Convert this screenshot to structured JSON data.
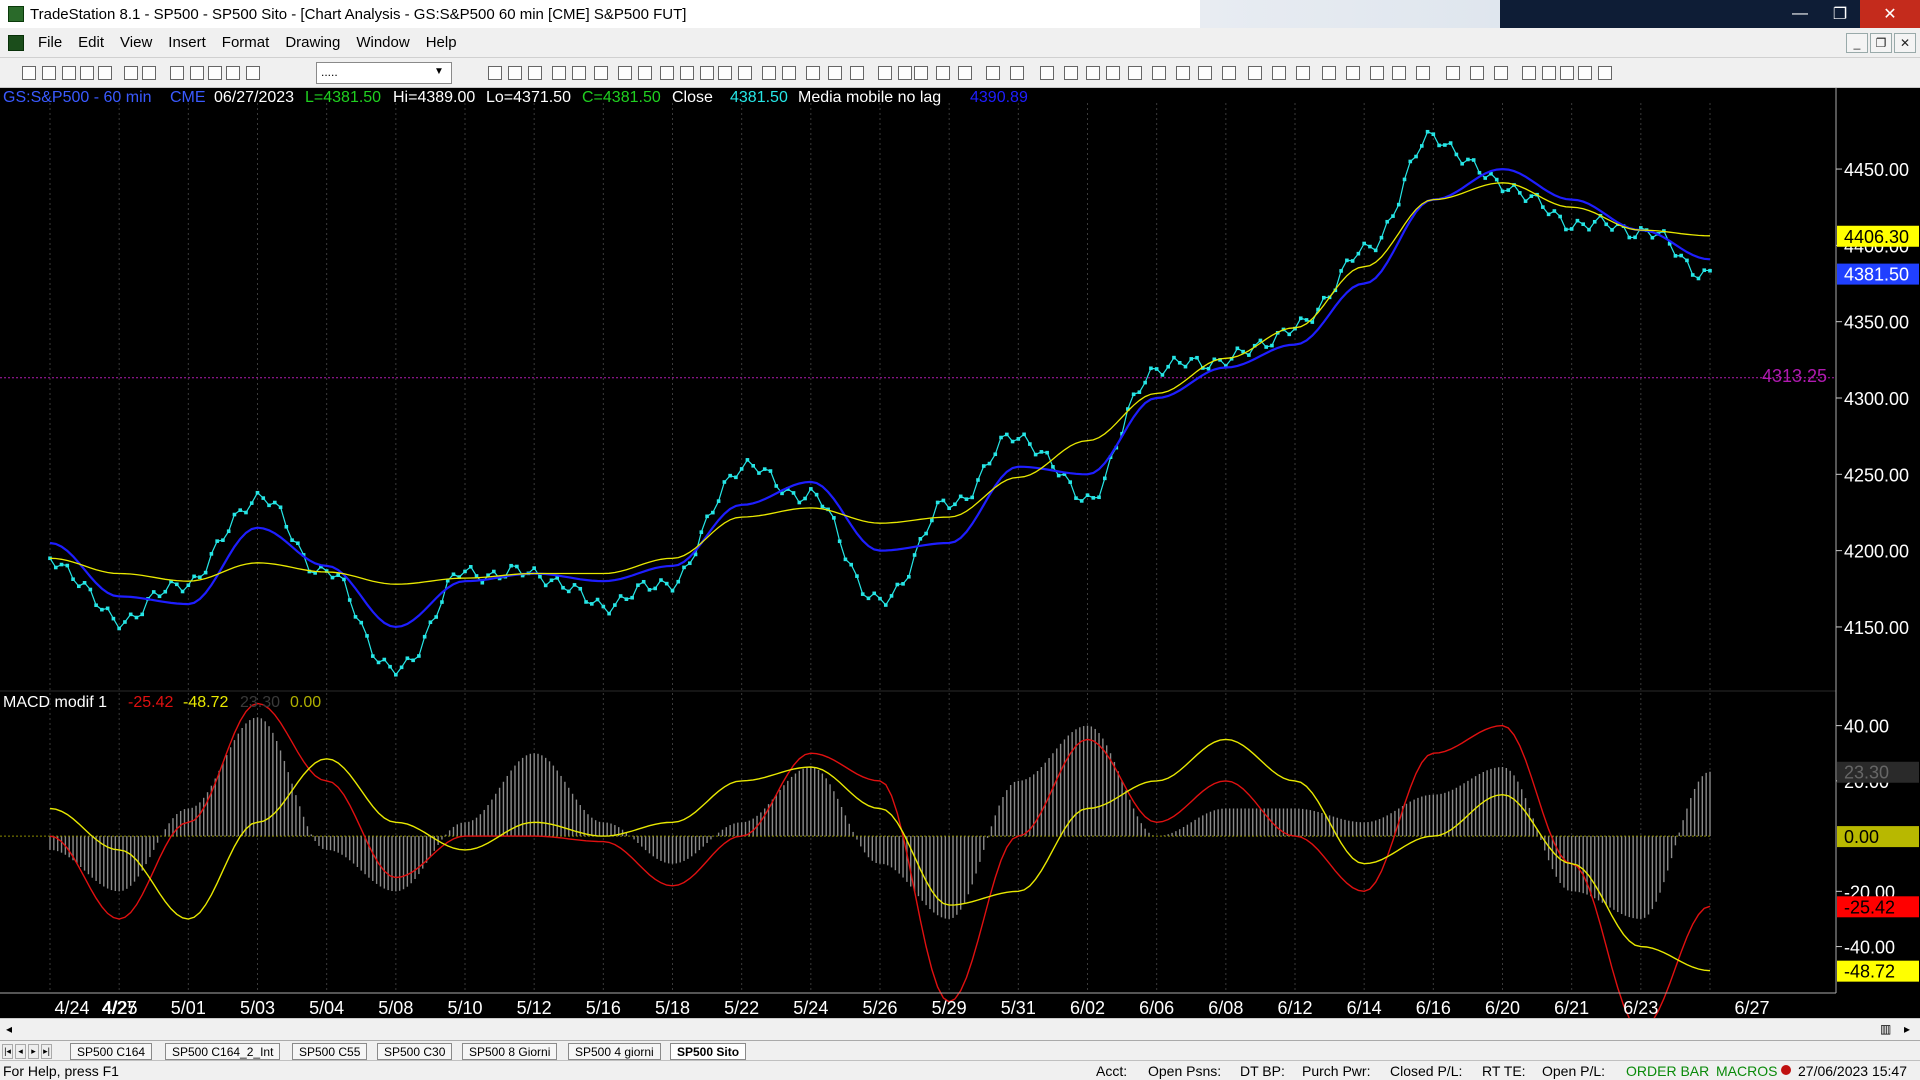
{
  "window": {
    "title": "TradeStation 8.1 - SP500 - SP500 Sito - [Chart Analysis - GS:S&P500  60 min  [CME] S&P500 FUT]",
    "min_glyph": "—",
    "max_glyph": "❐",
    "close_glyph": "✕"
  },
  "menu": [
    "File",
    "Edit",
    "View",
    "Insert",
    "Format",
    "Drawing",
    "Window",
    "Help"
  ],
  "mdi": {
    "min": "_",
    "restore": "❐",
    "close": "✕"
  },
  "toolbar": {
    "symbol_value": "....."
  },
  "chart_header": {
    "symbol": "GS:S&P500 - 60 min",
    "exchange": "CME",
    "date": "06/27/2023",
    "last": "L=4381.50",
    "high": "Hi=4389.00",
    "low": "Lo=4371.50",
    "close": "C=4381.50",
    "close_label": "Close",
    "close_value": "4381.50",
    "ma_label": "Media mobile no lag",
    "ma_value": "4390.89",
    "reference_line": "4313.25"
  },
  "macd_header": {
    "label": "MACD modif 1",
    "macd": "-25.42",
    "signal": "-48.72",
    "hist": "23.30",
    "zero": "0.00"
  },
  "price_axis": {
    "ticks": [
      "4450.00",
      "4400.00",
      "4350.00",
      "4300.00",
      "4250.00",
      "4200.00",
      "4150.00"
    ],
    "tags": [
      "4406.30",
      "4381.50"
    ]
  },
  "macd_axis": {
    "ticks": [
      "40.00",
      "20.00",
      "-20.00",
      "-40.00"
    ],
    "tags": [
      "23.30",
      "0.00",
      "-25.42",
      "-48.72"
    ]
  },
  "date_axis": [
    "4/24",
    "4/25",
    "4/27",
    "5/01",
    "5/03",
    "5/04",
    "5/08",
    "5/10",
    "5/12",
    "5/16",
    "5/18",
    "5/22",
    "5/24",
    "5/26",
    "5/29",
    "5/31",
    "6/02",
    "6/06",
    "6/08",
    "6/12",
    "6/14",
    "6/16",
    "6/20",
    "6/21",
    "6/23",
    "6/27"
  ],
  "colors": {
    "price": "#26e6e6",
    "ma_fast": "#1e1eff",
    "ma_slow": "#e8e800",
    "macd": "#e01010",
    "signal": "#e8e800",
    "histogram": "#8a8a8a",
    "reference": "#b01ab0"
  },
  "tabs": [
    "SP500 C164",
    "SP500 C164_2_Int",
    "SP500 C55",
    "SP500 C30",
    "SP500 8 Giorni",
    "SP500 4 giorni",
    "SP500 Sito"
  ],
  "status": {
    "help": "For Help, press F1",
    "acct": "Acct:",
    "open_psns": "Open Psns:",
    "dt_bp": "DT BP:",
    "purch_pwr": "Purch Pwr:",
    "closed_pl": "Closed P/L:",
    "rt_te": "RT TE:",
    "open_pl": "Open P/L:",
    "order_bar": "ORDER BAR",
    "macros": "MACROS",
    "datetime": "27/06/2023 15:47"
  },
  "chart_data": {
    "type": "line",
    "x": [
      "4/24",
      "4/25",
      "4/27",
      "5/01",
      "5/03",
      "5/04",
      "5/08",
      "5/10",
      "5/12",
      "5/16",
      "5/18",
      "5/22",
      "5/24",
      "5/26",
      "5/29",
      "5/31",
      "6/02",
      "6/06",
      "6/08",
      "6/12",
      "6/14",
      "6/16",
      "6/20",
      "6/21",
      "6/23"
    ],
    "ylim": [
      4110,
      4490
    ],
    "reference": 4313.25,
    "series": [
      {
        "values": [
          4195,
          4155,
          4180,
          4235,
          4185,
          4120,
          4185,
          4185,
          4165,
          4180,
          4255,
          4235,
          4165,
          4230,
          4275,
          4235,
          4320,
          4325,
          4345,
          4395,
          4470,
          4440,
          4415,
          4410,
          4381.5
        ]
      },
      {
        "values": [
          4205,
          4170,
          4165,
          4215,
          4190,
          4150,
          4180,
          4185,
          4180,
          4190,
          4230,
          4245,
          4200,
          4205,
          4255,
          4250,
          4300,
          4320,
          4335,
          4375,
          4430,
          4450,
          4430,
          4410,
          4390.89
        ]
      },
      {
        "values": [
          4195,
          4185,
          4180,
          4192,
          4186,
          4178,
          4182,
          4185,
          4185,
          4195,
          4222,
          4228,
          4218,
          4222,
          4248,
          4272,
          4303,
          4326,
          4346,
          4386,
          4430,
          4441,
          4425,
          4410,
          4406.3
        ]
      }
    ],
    "macd_ylim": [
      -55,
      50
    ],
    "macd": [
      0,
      -30,
      5,
      48,
      20,
      -15,
      0,
      0,
      -2,
      -18,
      0,
      30,
      20,
      -60,
      0,
      35,
      5,
      20,
      0,
      -20,
      30,
      40,
      -10,
      -70,
      -25.42
    ],
    "signal": [
      10,
      -5,
      -30,
      5,
      28,
      5,
      -5,
      5,
      0,
      5,
      20,
      25,
      10,
      -25,
      -20,
      10,
      20,
      35,
      20,
      -10,
      0,
      15,
      -10,
      -40,
      -48.72
    ],
    "histogram": [
      -5,
      -20,
      10,
      43,
      -5,
      -20,
      5,
      30,
      5,
      -10,
      5,
      25,
      -10,
      -30,
      20,
      40,
      0,
      10,
      10,
      5,
      15,
      25,
      -20,
      -30,
      23.3
    ]
  }
}
